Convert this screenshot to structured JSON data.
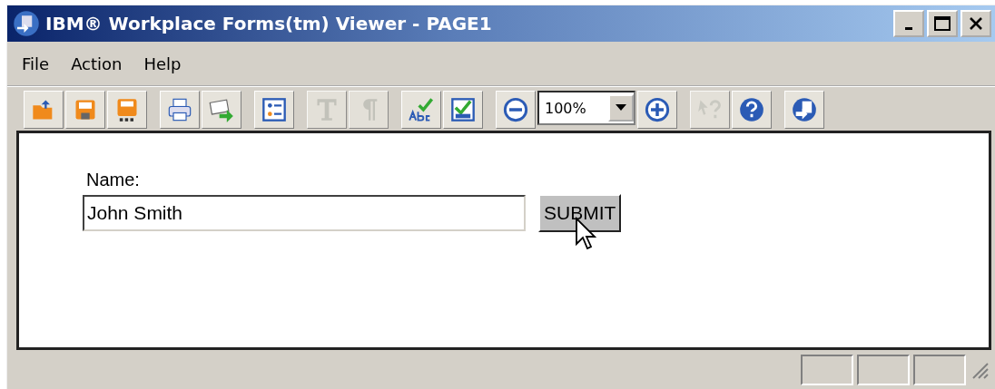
{
  "window": {
    "title": "IBM® Workplace Forms(tm) Viewer - PAGE1"
  },
  "menu": [
    {
      "label": "File"
    },
    {
      "label": "Action"
    },
    {
      "label": "Help"
    }
  ],
  "toolbar": {
    "groups": [
      [
        {
          "kind": "button",
          "disabled": false
        },
        {
          "kind": "button",
          "disabled": false
        },
        {
          "kind": "button",
          "disabled": false
        }
      ],
      [
        {
          "kind": "button",
          "disabled": false
        },
        {
          "kind": "button",
          "disabled": false
        }
      ],
      [
        {
          "kind": "button",
          "disabled": false
        }
      ],
      [
        {
          "kind": "button",
          "disabled": true
        },
        {
          "kind": "button",
          "disabled": true
        }
      ],
      [
        {
          "kind": "button",
          "disabled": false
        },
        {
          "kind": "button",
          "disabled": false
        }
      ],
      [
        {
          "kind": "button",
          "disabled": false
        },
        {
          "kind": "combo",
          "value": "100%"
        },
        {
          "kind": "button",
          "disabled": false
        }
      ],
      [
        {
          "kind": "button",
          "disabled": true
        },
        {
          "kind": "button",
          "disabled": false
        }
      ],
      [
        {
          "kind": "button",
          "disabled": false
        }
      ]
    ]
  },
  "form": {
    "label": "Name:",
    "value": "John Smith",
    "button": "SUBMIT"
  }
}
